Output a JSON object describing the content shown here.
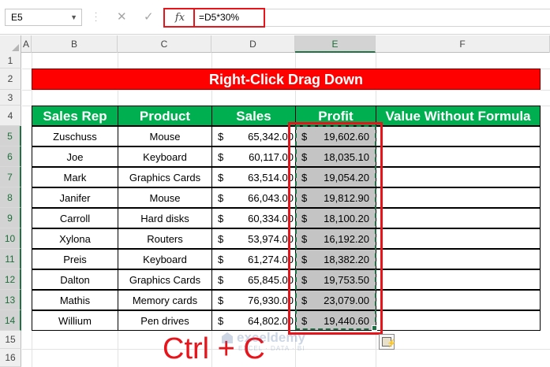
{
  "formula_bar": {
    "name_box": "E5",
    "cancel_glyph": "✕",
    "enter_glyph": "✓",
    "fx_label": "fx",
    "formula": "=D5*30%"
  },
  "columns": [
    "A",
    "B",
    "C",
    "D",
    "E",
    "F"
  ],
  "selected_column": "E",
  "rows": [
    "1",
    "2",
    "3",
    "4",
    "5",
    "6",
    "7",
    "8",
    "9",
    "10",
    "11",
    "12",
    "13",
    "14",
    "15",
    "16"
  ],
  "selected_rows": [
    "5",
    "6",
    "7",
    "8",
    "9",
    "10",
    "11",
    "12",
    "13",
    "14"
  ],
  "banner_title": "Right-Click Drag Down",
  "table": {
    "headers": [
      "Sales Rep",
      "Product",
      "Sales",
      "Profit",
      "Value Without Formula"
    ],
    "currency_symbol": "$",
    "rows": [
      {
        "rep": "Zuschuss",
        "product": "Mouse",
        "sales": "65,342.00",
        "profit": "19,602.60"
      },
      {
        "rep": "Joe",
        "product": "Keyboard",
        "sales": "60,117.00",
        "profit": "18,035.10"
      },
      {
        "rep": "Mark",
        "product": "Graphics Cards",
        "sales": "63,514.00",
        "profit": "19,054.20"
      },
      {
        "rep": "Janifer",
        "product": "Mouse",
        "sales": "66,043.00",
        "profit": "19,812.90"
      },
      {
        "rep": "Carroll",
        "product": "Hard disks",
        "sales": "60,334.00",
        "profit": "18,100.20"
      },
      {
        "rep": "Xylona",
        "product": "Routers",
        "sales": "53,974.00",
        "profit": "16,192.20"
      },
      {
        "rep": "Preis",
        "product": "Keyboard",
        "sales": "61,274.00",
        "profit": "18,382.20"
      },
      {
        "rep": "Dalton",
        "product": "Graphics Cards",
        "sales": "65,845.00",
        "profit": "19,753.50"
      },
      {
        "rep": "Mathis",
        "product": "Memory cards",
        "sales": "76,930.00",
        "profit": "23,079.00"
      },
      {
        "rep": "Willium",
        "product": "Pen drives",
        "sales": "64,802.00",
        "profit": "19,440.60"
      }
    ]
  },
  "annotation": "Ctrl + C",
  "watermark": {
    "name": "exceldemy",
    "tagline": "EXCEL · DATA · BI"
  },
  "colors": {
    "banner": "#ff0000",
    "header_green": "#00b050",
    "highlight_red": "#e8141b",
    "copy_border": "#1e7145",
    "profit_fill": "#c4c4c4"
  }
}
